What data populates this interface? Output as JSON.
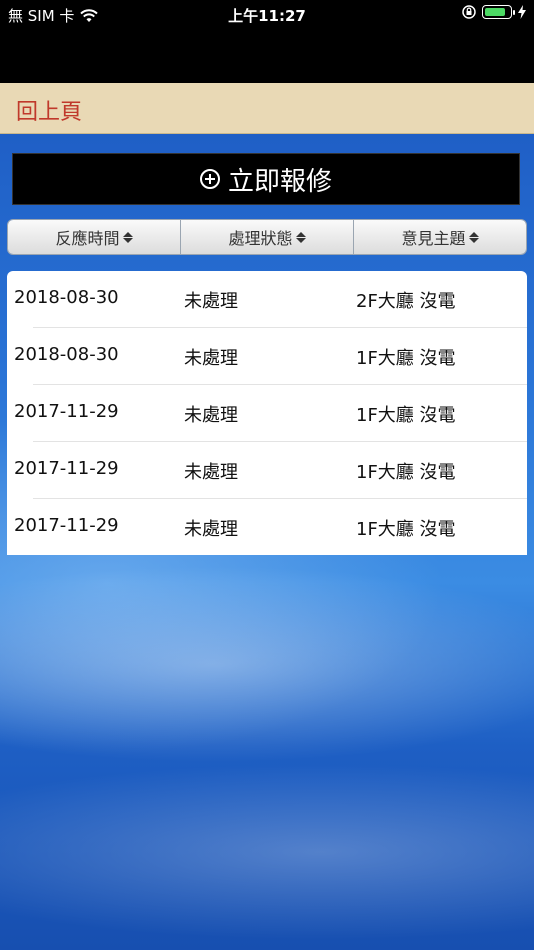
{
  "status_bar": {
    "carrier": "無 SIM 卡",
    "time": "上午11:27",
    "battery_level": 0.85,
    "battery_color": "#4cd964"
  },
  "nav": {
    "back_label": "回上頁"
  },
  "report_button": {
    "label": "立即報修",
    "icon": "plus-circle-icon"
  },
  "sort_header": {
    "columns": [
      "反應時間",
      "處理狀態",
      "意見主題"
    ]
  },
  "list": {
    "rows": [
      {
        "date": "2018-08-30",
        "status": "未處理",
        "topic": "2F大廳 沒電"
      },
      {
        "date": "2018-08-30",
        "status": "未處理",
        "topic": "1F大廳 沒電"
      },
      {
        "date": "2017-11-29",
        "status": "未處理",
        "topic": "1F大廳 沒電"
      },
      {
        "date": "2017-11-29",
        "status": "未處理",
        "topic": "1F大廳 沒電"
      },
      {
        "date": "2017-11-29",
        "status": "未處理",
        "topic": "1F大廳 沒電"
      }
    ]
  }
}
